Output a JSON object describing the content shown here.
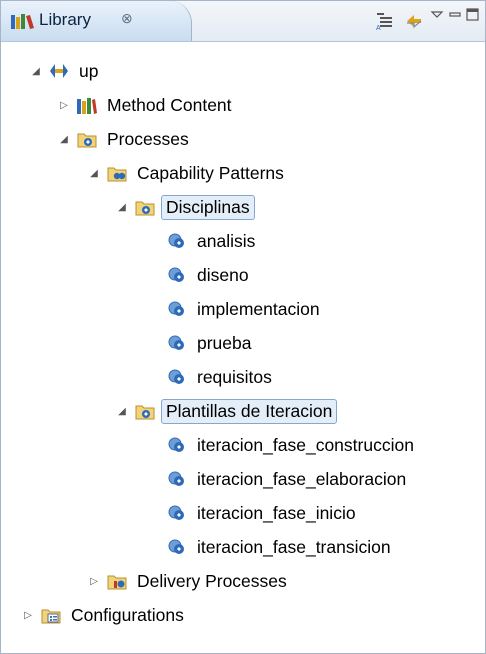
{
  "view": {
    "title": "Library",
    "close_glyph": "⊗",
    "toolbar_icons": [
      "collapse-all-icon",
      "link-with-editor-icon",
      "view-menu-icon",
      "minimize-icon",
      "maximize-icon"
    ]
  },
  "tree": {
    "items": [
      {
        "label": "up",
        "icon": "method-plugin-icon",
        "expanded": true
      },
      {
        "label": "Method Content",
        "icon": "method-content-icon",
        "expanded": false
      },
      {
        "label": "Processes",
        "icon": "processes-folder-icon",
        "expanded": true
      },
      {
        "label": "Capability Patterns",
        "icon": "capability-patterns-folder-icon",
        "expanded": true
      },
      {
        "label": "Disciplinas",
        "icon": "process-folder-icon",
        "expanded": true,
        "selected": true
      },
      {
        "label": "analisis",
        "icon": "capability-pattern-icon"
      },
      {
        "label": "diseno",
        "icon": "capability-pattern-icon"
      },
      {
        "label": "implementacion",
        "icon": "capability-pattern-icon"
      },
      {
        "label": "prueba",
        "icon": "capability-pattern-icon"
      },
      {
        "label": "requisitos",
        "icon": "capability-pattern-icon"
      },
      {
        "label": "Plantillas de Iteracion",
        "icon": "process-folder-icon",
        "expanded": true,
        "selected": true
      },
      {
        "label": "iteracion_fase_construccion",
        "icon": "capability-pattern-icon"
      },
      {
        "label": "iteracion_fase_elaboracion",
        "icon": "capability-pattern-icon"
      },
      {
        "label": "iteracion_fase_inicio",
        "icon": "capability-pattern-icon"
      },
      {
        "label": "iteracion_fase_transicion",
        "icon": "capability-pattern-icon"
      },
      {
        "label": "Delivery Processes",
        "icon": "delivery-processes-folder-icon",
        "expanded": false
      },
      {
        "label": "Configurations",
        "icon": "configurations-folder-icon",
        "expanded": false
      }
    ]
  }
}
